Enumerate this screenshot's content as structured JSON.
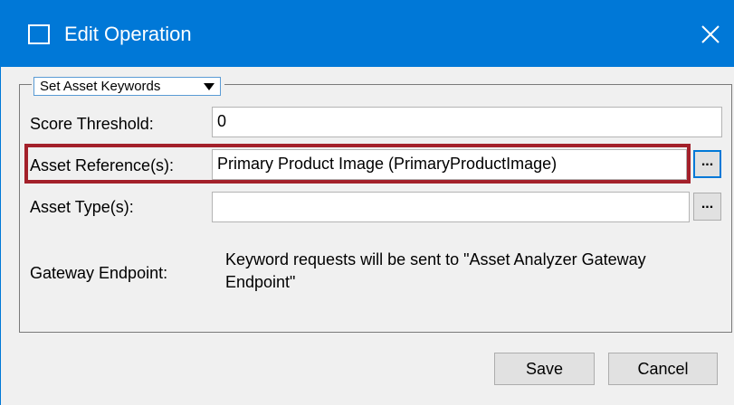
{
  "window": {
    "title": "Edit Operation",
    "accent": "#0078d7"
  },
  "operation": {
    "selected": "Set Asset Keywords"
  },
  "form": {
    "score_threshold": {
      "label": "Score Threshold:",
      "value": "0"
    },
    "asset_reference": {
      "label": "Asset Reference(s):",
      "value": "Primary Product Image (PrimaryProductImage)",
      "browse": "..."
    },
    "asset_type": {
      "label": "Asset Type(s):",
      "value": "",
      "browse": "..."
    },
    "gateway_endpoint": {
      "label": "Gateway Endpoint:",
      "info": "Keyword requests will be sent to \"Asset Analyzer Gateway Endpoint\""
    }
  },
  "highlight_color": "#a3202a",
  "buttons": {
    "save": "Save",
    "cancel": "Cancel"
  },
  "icons": {
    "window": "window-icon",
    "close": "close-icon",
    "dropdown": "chevron-down-icon"
  }
}
